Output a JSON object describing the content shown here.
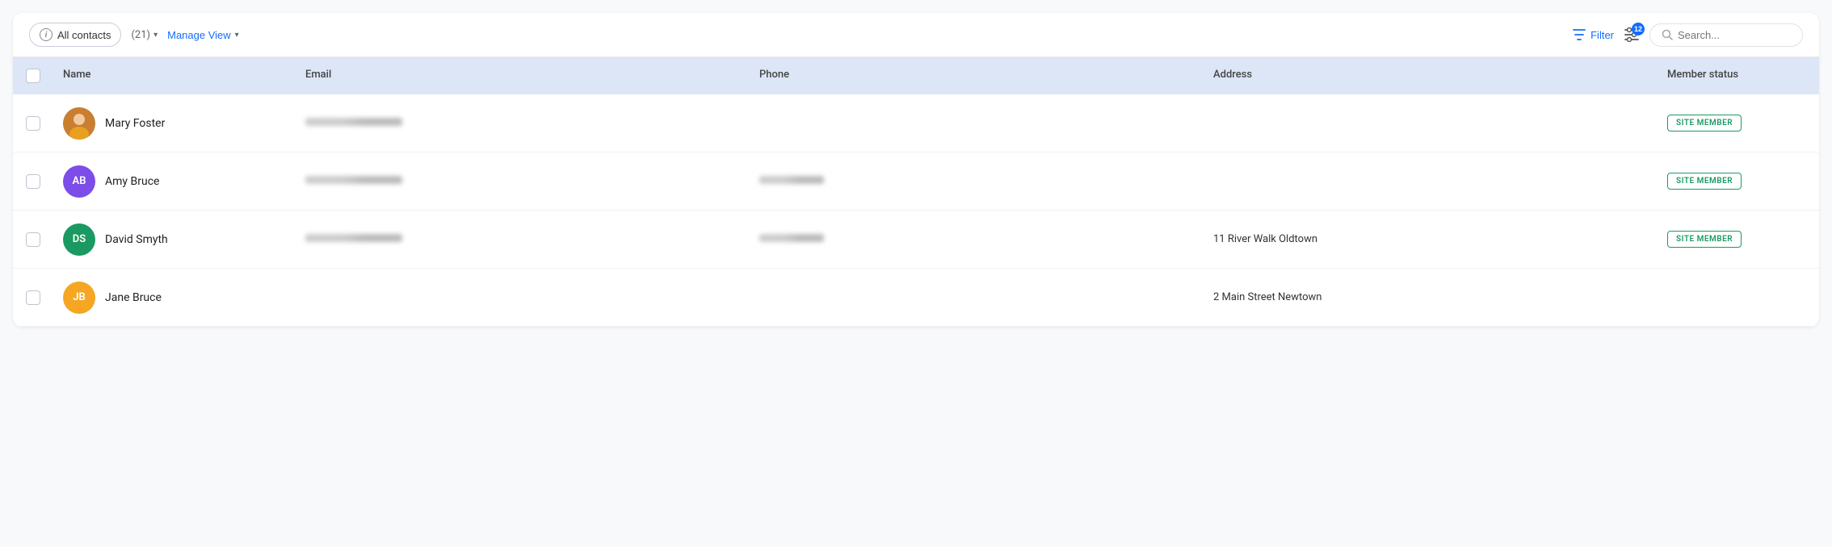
{
  "toolbar": {
    "all_contacts_label": "All contacts",
    "count": "(21)",
    "manage_view_label": "Manage View",
    "filter_label": "Filter",
    "columns_badge": "12",
    "search_placeholder": "Search..."
  },
  "table": {
    "headers": {
      "name": "Name",
      "email": "Email",
      "phone": "Phone",
      "address": "Address",
      "member_status": "Member status"
    },
    "rows": [
      {
        "id": "mary-foster",
        "name": "Mary Foster",
        "initials": "",
        "avatar_color": "#888",
        "has_photo": true,
        "email_blurred": true,
        "phone_blurred": false,
        "phone": "",
        "address": "",
        "member_status": "SITE MEMBER",
        "is_member": true
      },
      {
        "id": "amy-bruce",
        "name": "Amy Bruce",
        "initials": "AB",
        "avatar_color": "#7c4de8",
        "has_photo": false,
        "email_blurred": true,
        "phone_blurred": true,
        "phone": "",
        "address": "",
        "member_status": "SITE MEMBER",
        "is_member": true
      },
      {
        "id": "david-smyth",
        "name": "David Smyth",
        "initials": "DS",
        "avatar_color": "#1b9962",
        "has_photo": false,
        "email_blurred": true,
        "phone_blurred": true,
        "phone": "",
        "address": "11 River Walk Oldtown",
        "member_status": "SITE MEMBER",
        "is_member": true
      },
      {
        "id": "jane-bruce",
        "name": "Jane Bruce",
        "initials": "JB",
        "avatar_color": "#f5a623",
        "has_photo": false,
        "email_blurred": false,
        "phone_blurred": false,
        "phone": "",
        "address": "2 Main Street Newtown",
        "member_status": "",
        "is_member": false
      }
    ]
  }
}
